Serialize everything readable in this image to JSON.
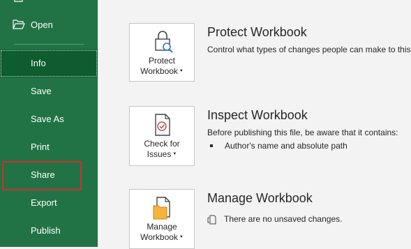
{
  "sidebar": {
    "open_label": "Open",
    "items": [
      {
        "label": "Info"
      },
      {
        "label": "Save"
      },
      {
        "label": "Save As"
      },
      {
        "label": "Print"
      },
      {
        "label": "Share"
      },
      {
        "label": "Export"
      },
      {
        "label": "Publish"
      }
    ]
  },
  "sections": {
    "protect": {
      "button_line1": "Protect",
      "button_line2": "Workbook",
      "title": "Protect Workbook",
      "description": "Control what types of changes people can make to this"
    },
    "inspect": {
      "button_line1": "Check for",
      "button_line2": "Issues",
      "title": "Inspect Workbook",
      "description": "Before publishing this file, be aware that it contains:",
      "bullets": [
        "Author's name and absolute path"
      ]
    },
    "manage": {
      "button_line1": "Manage",
      "button_line2": "Workbook",
      "title": "Manage Workbook",
      "status": "There are no unsaved changes."
    }
  },
  "colors": {
    "sidebar_bg": "#217346",
    "sidebar_selected": "#0e5c30",
    "highlight_border": "#d12f2f"
  }
}
